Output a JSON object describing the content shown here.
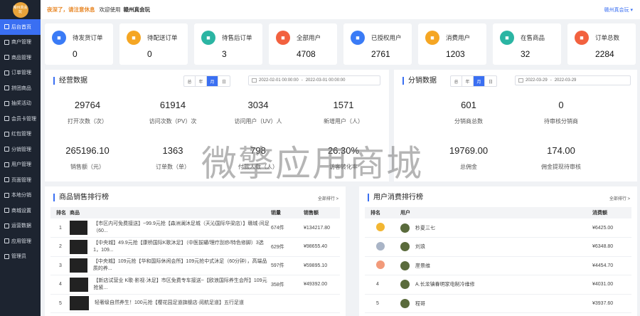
{
  "logo": {
    "text": "赣州真会玩"
  },
  "sidebar": {
    "items": [
      {
        "label": "后台首页",
        "icon": "home-icon",
        "active": true
      },
      {
        "label": "商户管理",
        "icon": "shop-icon"
      },
      {
        "label": "商品管理",
        "icon": "goods-icon"
      },
      {
        "label": "订单管理",
        "icon": "order-icon"
      },
      {
        "label": "拼团商品",
        "icon": "group-icon"
      },
      {
        "label": "抽奖活动",
        "icon": "lottery-icon"
      },
      {
        "label": "会员卡管理",
        "icon": "card-icon"
      },
      {
        "label": "红包管理",
        "icon": "redpacket-icon"
      },
      {
        "label": "分销管理",
        "icon": "distribution-icon"
      },
      {
        "label": "用户管理",
        "icon": "user-icon"
      },
      {
        "label": "页面管理",
        "icon": "page-icon"
      },
      {
        "label": "本地分销",
        "icon": "local-icon"
      },
      {
        "label": "商城设置",
        "icon": "settings-icon"
      },
      {
        "label": "运营数据",
        "icon": "data-icon"
      },
      {
        "label": "应用管理",
        "icon": "app-icon"
      },
      {
        "label": "管理员",
        "icon": "admin-icon"
      }
    ]
  },
  "topbar": {
    "warning": "夜深了，请注意休息",
    "welcome": "欢迎使用",
    "store": "赣州真会玩",
    "account": "赣州真会玩 ▾"
  },
  "stats": [
    {
      "label": "待发货订单",
      "value": "0",
      "color": "#3a7bf6",
      "icon": "box-icon"
    },
    {
      "label": "待配送订单",
      "value": "0",
      "color": "#f5a623",
      "icon": "delivery-icon"
    },
    {
      "label": "待售后订单",
      "value": "3",
      "color": "#2bb5a3",
      "icon": "service-icon"
    },
    {
      "label": "全部用户",
      "value": "4708",
      "color": "#f2613f",
      "icon": "users-icon"
    },
    {
      "label": "已授权用户",
      "value": "2761",
      "color": "#3a7bf6",
      "icon": "auth-icon"
    },
    {
      "label": "消费用户",
      "value": "1203",
      "color": "#f5a623",
      "icon": "wallet-icon"
    },
    {
      "label": "在售商品",
      "value": "32",
      "color": "#2bb5a3",
      "icon": "bag-icon"
    },
    {
      "label": "订单总数",
      "value": "2284",
      "color": "#f2613f",
      "icon": "list-icon"
    }
  ],
  "business": {
    "title": "经营数据",
    "tabs": [
      "总",
      "年",
      "月",
      "日"
    ],
    "active_tab": "月",
    "date_start": "2022-02-01 00:00:00",
    "date_sep": "-",
    "date_end": "2022-03-01 00:00:00",
    "metrics": [
      {
        "value": "29764",
        "label": "打开次数（次）"
      },
      {
        "value": "61914",
        "label": "访问次数（PV）次"
      },
      {
        "value": "3034",
        "label": "访问用户（UV）人"
      },
      {
        "value": "1571",
        "label": "新增用户（人）"
      },
      {
        "value": "265196.10",
        "label": "销售额（元）"
      },
      {
        "value": "1363",
        "label": "订单数（单）"
      },
      {
        "value": "798",
        "label": "付款人数（人）"
      },
      {
        "value": "26.30%",
        "label": "访客转化率"
      }
    ]
  },
  "distribution": {
    "title": "分销数据",
    "tabs": [
      "总",
      "年",
      "月",
      "日"
    ],
    "active_tab": "月",
    "date_start": "2022-03-29",
    "date_sep": "-",
    "date_end": "2022-03-29",
    "metrics": [
      {
        "value": "601",
        "label": "分销商总数"
      },
      {
        "value": "0",
        "label": "待审核分销商"
      },
      {
        "value": "19769.00",
        "label": "总佣金"
      },
      {
        "value": "174.00",
        "label": "佣金提现待审核"
      }
    ]
  },
  "goods_rank": {
    "title": "商品销售排行榜",
    "more": "全部排行 >",
    "headers": [
      "排名",
      "商品",
      "销量",
      "销售额"
    ],
    "rows": [
      {
        "rank": "1",
        "name": "【市区内可免费接送】~99.9元抢【森洲澜沐足城（天沁国际华梁店）】赣城·间足（60...",
        "qty": "674件",
        "amount": "¥134217.80"
      },
      {
        "rank": "2",
        "name": "【中央城】49.9元抢【康桥国际K歌沐足】（中医拔罐/理疗刮痧/特色修脚）3选1，109...",
        "qty": "629件",
        "amount": "¥98655.40"
      },
      {
        "rank": "3",
        "name": "【中央城】109元抢【华和国际休闲会所】109元抢中式沐足（60分钟），高端品质的养...",
        "qty": "597件",
        "amount": "¥59895.10"
      },
      {
        "rank": "4",
        "name": "【新店试营业 K歌·影视·沐足】市区免费专车接送~【欧浪国际养生会所】109元抢紧...",
        "qty": "358件",
        "amount": "¥49392.00"
      },
      {
        "rank": "5",
        "name": "轻奢级自然养生！100元抢【樱花园足道旗舰店·阅航足道】五行足道",
        "qty": "",
        "amount": ""
      }
    ]
  },
  "user_rank": {
    "title": "用户消费排行榜",
    "more": "全部排行 >",
    "headers": [
      "排名",
      "用户",
      "消费额"
    ],
    "rows": [
      {
        "rank": "1",
        "name": "秒夏三七",
        "amount": "¥6425.00",
        "medal": "#f2b632"
      },
      {
        "rank": "2",
        "name": "刘浪",
        "amount": "¥6348.80",
        "medal": "#a9b4c6"
      },
      {
        "rank": "3",
        "name": "崖景维",
        "amount": "¥4454.70",
        "medal": "#f29a7a"
      },
      {
        "rank": "4",
        "name": "A.长龙镇春明家电制冷维修",
        "amount": "¥4031.00",
        "medal": ""
      },
      {
        "rank": "5",
        "name": "程哥",
        "amount": "¥3937.60",
        "medal": ""
      }
    ]
  },
  "watermark": "微擎应用商城"
}
